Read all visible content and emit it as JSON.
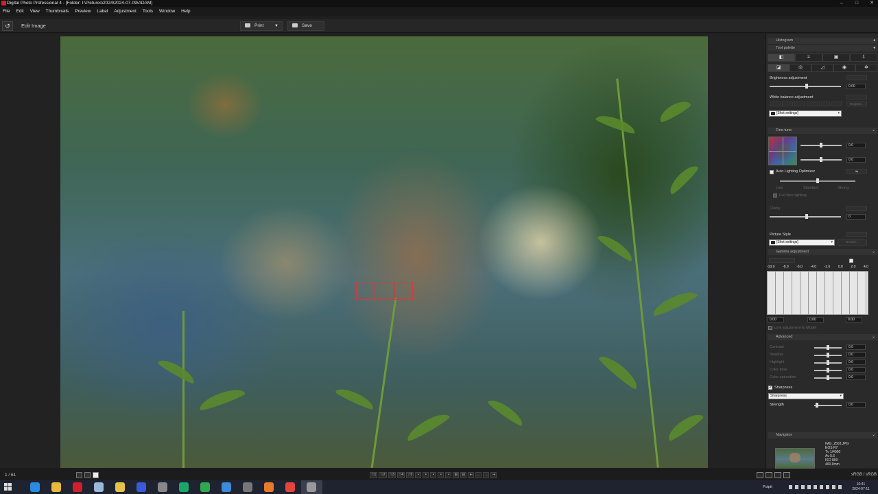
{
  "window": {
    "title": "Digital Photo Professional 4 - [Folder: I:\\Pictures\\2024\\2024-07-09\\ADAM]",
    "buttons": [
      "–",
      "□",
      "✕"
    ]
  },
  "menu": [
    "File",
    "Edit",
    "View",
    "Thumbnails",
    "Preview",
    "Label",
    "Adjustment",
    "Tools",
    "Window",
    "Help"
  ],
  "toolbar": {
    "back_icon": "↺",
    "title": "Edit Image",
    "print_label": "Print",
    "print_dropdown": "▼",
    "save_label": "Save"
  },
  "panel": {
    "histogram_header": "Histogram",
    "tool_palette_header": "Tool palette",
    "top_tabs": [
      "◧",
      "⌗",
      "▣",
      "⇩"
    ],
    "sub_tabs": [
      "◪",
      "◎",
      "◿",
      "◉",
      "✲"
    ],
    "brightness_label": "Brightness adjustment",
    "brightness_value": "0.00",
    "white_balance_label": "White balance adjustment",
    "wb_select": "[Shot settings]",
    "wb_register": "Register...",
    "finetune_header": "Fine-tune",
    "finetune_a": "0.0",
    "finetune_b": "0.0",
    "alo_label": "Auto Lighting Optimizer",
    "alo_levels": [
      "Low",
      "Standard",
      "Strong"
    ],
    "alo_face": "Full face lighting",
    "clarity_label": "Clarity",
    "clarity_value": "0",
    "picture_style_label": "Picture Style",
    "picture_style_select": "[Shot settings]",
    "picture_style_browse": "Browse...",
    "gamma_header": "Gamma adjustment",
    "gamma_ticks": [
      "-10.0",
      "-8.0",
      "-6.0",
      "-4.0",
      "-2.0",
      "0.0",
      "2.0",
      "4.0"
    ],
    "gamma_values": [
      "0.00",
      "0.00",
      "0.00"
    ],
    "gamma_check": "Link adjustment to Model",
    "advanced_header": "Advanced",
    "advanced_rows": [
      "Contrast",
      "Shadow",
      "Highlight",
      "Color tone",
      "Color saturation"
    ],
    "advanced_values": [
      "0.0",
      "0.0",
      "0.0",
      "0.0",
      "0.0"
    ],
    "sharpness_check": "Sharpness",
    "sharpness_select": "Sharpness",
    "strength_label": "Strength",
    "strength_value": "0.0",
    "navigator_header": "Navigator",
    "nav_info": "IMG_2503.JPG\nEOS R7\nTv 1/4000\nAv 5.6\nISO 800\n400.0mm"
  },
  "statusbar": {
    "count": "1 / 61",
    "center_buttons": [
      "☆1",
      "☆2",
      "☆3",
      "☆4",
      "☆5",
      "•",
      "•",
      "•",
      "•",
      "•",
      "⊞",
      "⊟",
      "⇤",
      "←",
      "→",
      "⇥"
    ],
    "color_space": "sRGB / sRGB"
  },
  "taskbar": {
    "apps": [
      {
        "name": "edge",
        "color": "#2b8be0"
      },
      {
        "name": "explorer",
        "color": "#e8b93a"
      },
      {
        "name": "opera",
        "color": "#d0202a"
      },
      {
        "name": "notepad",
        "color": "#9ab8d8"
      },
      {
        "name": "batman",
        "color": "#e6c24a"
      },
      {
        "name": "save-app",
        "color": "#3a5ad8"
      },
      {
        "name": "tool-app",
        "color": "#888888"
      },
      {
        "name": "green-app",
        "color": "#1aa86a"
      },
      {
        "name": "share-app",
        "color": "#2fa84f"
      },
      {
        "name": "store-app",
        "color": "#3c8ad8"
      },
      {
        "name": "camera-app",
        "color": "#777777"
      },
      {
        "name": "firefox",
        "color": "#e87a2a"
      },
      {
        "name": "chrome",
        "color": "#e2453a"
      },
      {
        "name": "dpp",
        "color": "#999999"
      }
    ],
    "tray_label": "Pulpit",
    "time": "10:41",
    "date": "2024-07-11"
  }
}
